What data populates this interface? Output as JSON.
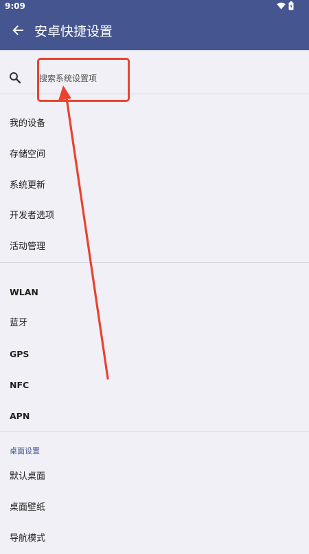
{
  "status_bar": {
    "time": "9:09",
    "icons": [
      "wifi-icon",
      "battery-icon"
    ]
  },
  "app_bar": {
    "title": "安卓快捷设置",
    "back_icon": "arrow-left-icon"
  },
  "search": {
    "icon": "search-icon",
    "placeholder": "搜索系统设置项"
  },
  "group_system": {
    "items": [
      "我的设备",
      "存储空间",
      "系统更新",
      "开发者选项",
      "活动管理"
    ]
  },
  "group_connectivity": {
    "items": [
      "WLAN",
      "蓝牙",
      "GPS",
      "NFC",
      "APN"
    ]
  },
  "group_desktop": {
    "header": "桌面设置",
    "items": [
      "默认桌面",
      "桌面壁纸",
      "导航模式"
    ]
  },
  "colors": {
    "app_bar": "#44558f",
    "background": "#f1f0f7",
    "annotation": "#e8432f"
  }
}
